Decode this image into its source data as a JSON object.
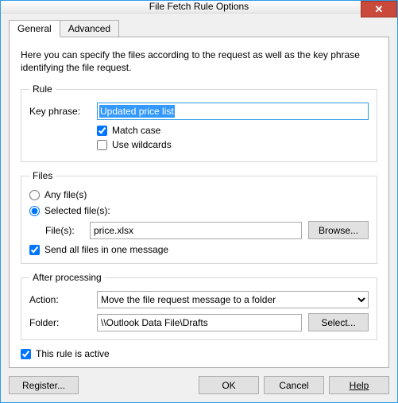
{
  "window": {
    "title": "File Fetch Rule Options"
  },
  "tabs": {
    "general": "General",
    "advanced": "Advanced"
  },
  "intro": "Here you can specify the files according to the request as well as the key phrase identifying the file request.",
  "rule": {
    "legend": "Rule",
    "key_phrase_label": "Key phrase:",
    "key_phrase_value": "Updated price list",
    "match_case_label": "Match case",
    "match_case_checked": true,
    "wildcards_label": "Use wildcards",
    "wildcards_checked": false
  },
  "files": {
    "legend": "Files",
    "any_label": "Any file(s)",
    "selected_label": "Selected file(s):",
    "mode": "selected",
    "files_label": "File(s):",
    "files_value": "price.xlsx",
    "browse_label": "Browse...",
    "send_all_label": "Send all files in one message",
    "send_all_checked": true
  },
  "after": {
    "legend": "After processing",
    "action_label": "Action:",
    "action_value": "Move the file request message to a folder",
    "folder_label": "Folder:",
    "folder_value": "\\\\Outlook Data File\\Drafts",
    "select_label": "Select..."
  },
  "active": {
    "label": "This rule is active",
    "checked": true
  },
  "buttons": {
    "register": "Register...",
    "ok": "OK",
    "cancel": "Cancel",
    "help": "Help"
  }
}
